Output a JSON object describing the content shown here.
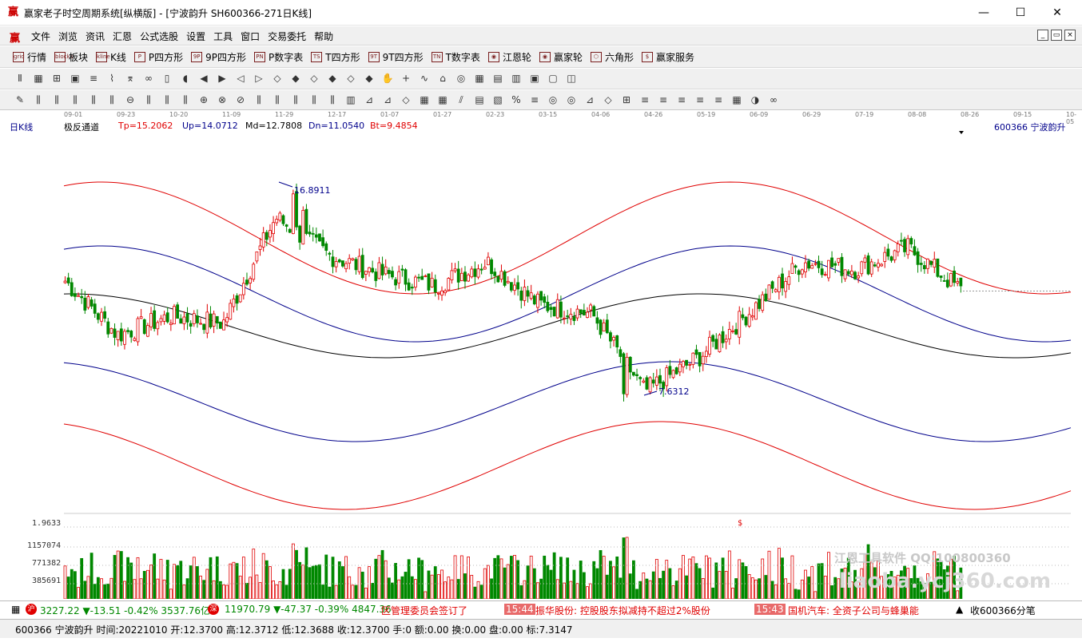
{
  "window": {
    "title": "赢家老子时空周期系统[纵横版] - [宁波韵升  SH600366-271日K线]",
    "controls": {
      "minimize": "—",
      "maximize": "☐",
      "close": "✕"
    }
  },
  "menu": [
    "文件",
    "浏览",
    "资讯",
    "汇恩",
    "公式选股",
    "设置",
    "工具",
    "窗口",
    "交易委托",
    "帮助"
  ],
  "toolbar1": [
    {
      "label": "行情",
      "icon": "grid"
    },
    {
      "label": "板块",
      "icon": "blocks"
    },
    {
      "label": "K线",
      "icon": "kline"
    },
    {
      "label": "P四方形",
      "icon": "P"
    },
    {
      "label": "9P四方形",
      "icon": "9P"
    },
    {
      "label": "P数字表",
      "icon": "PN"
    },
    {
      "label": "T四方形",
      "icon": "TS"
    },
    {
      "label": "9T四方形",
      "icon": "9T"
    },
    {
      "label": "T数字表",
      "icon": "TN"
    },
    {
      "label": "江恩轮",
      "icon": "◉"
    },
    {
      "label": "赢家轮",
      "icon": "◉"
    },
    {
      "label": "六角形",
      "icon": "⬡"
    },
    {
      "label": "赢家服务",
      "icon": "$"
    }
  ],
  "chart": {
    "period_label": "日K线",
    "indicator": "极反通道",
    "tp": "Tp=15.2062",
    "up": "Up=14.0712",
    "md": "Md=12.7808",
    "dn": "Dn=11.0540",
    "bt": "Bt=9.4854",
    "stock": "600366  宁波韵升",
    "high_label": "16.8911",
    "low_label": "7.6312",
    "dates": [
      "09-01",
      "09-23",
      "10-20",
      "11-09",
      "11-29",
      "12-17",
      "01-07",
      "01-27",
      "02-23",
      "03-15",
      "04-06",
      "04-26",
      "05-19",
      "06-09",
      "06-29",
      "07-19",
      "08-08",
      "08-26",
      "09-15",
      "10-05"
    ],
    "vol_axis": [
      "1.9633",
      "1157074",
      "771382",
      "385691"
    ],
    "dollar_mark": "$",
    "colors": {
      "up": "#e00000",
      "down": "#008800",
      "channel_outer": "#e00000",
      "channel_inner": "#00008b",
      "mid": "#000000"
    }
  },
  "chart_data": {
    "type": "candlestick",
    "title": "宁波韵升 600366 日K线",
    "x": [
      "09-01",
      "09-23",
      "10-20",
      "11-09",
      "11-29",
      "12-17",
      "01-07",
      "01-27",
      "02-23",
      "03-15",
      "04-06",
      "04-26",
      "05-19",
      "06-09",
      "06-29",
      "07-19",
      "08-08",
      "08-26",
      "09-15",
      "10-05"
    ],
    "close_approx": [
      12.8,
      10.5,
      11.3,
      11.0,
      15.5,
      13.9,
      13.1,
      12.6,
      13.6,
      11.8,
      11.4,
      8.1,
      9.5,
      11.5,
      13.6,
      13.3,
      14.2,
      12.4,
      null,
      null
    ],
    "channel": {
      "Tp": 15.2062,
      "Up": 14.0712,
      "Md": 12.7808,
      "Dn": 11.054,
      "Bt": 9.4854
    },
    "high_mark": 16.8911,
    "low_mark": 7.6312
  },
  "watermark": {
    "line1": "江恩工具软件  QQ:100800360",
    "line2": "liaoba.ycj360.com"
  },
  "ticker": {
    "sh": "3227.22 ▼-13.51 -0.42% 3537.76亿",
    "sz": "11970.79 ▼-47.37 -0.39% 4847.36",
    "news": "区管理委员会签订了",
    "t1": "15:44",
    "n1": "振华股份: 控股股东拟减持不超过2%股份",
    "t2": "15:43",
    "n2": "国机汽车: 全资子公司与蜂巢能",
    "right": "收600366分笔"
  },
  "bottom": "600366 宁波韵升 时间:20221010 开:12.3700 高:12.3712 低:12.3688 收:12.3700 手:0 额:0.00 换:0.00 盘:0.00 标:7.3147"
}
